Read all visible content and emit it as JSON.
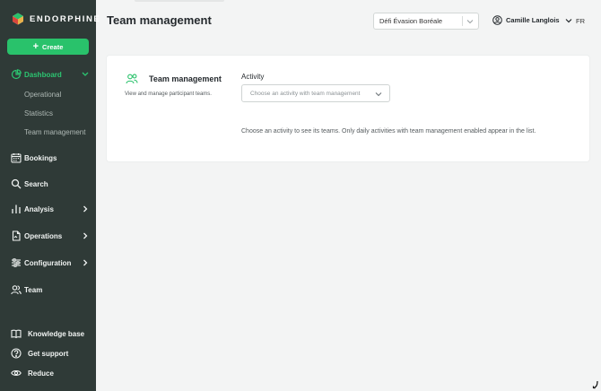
{
  "app": {
    "logo_text": "ENDORPHINE"
  },
  "sidebar": {
    "create_label": "Create",
    "nav": [
      {
        "label": "Dashboard",
        "icon": "chart-pie-icon",
        "active": true
      },
      {
        "label": "Bookings",
        "icon": "calendar-icon"
      },
      {
        "label": "Search",
        "icon": "search-icon"
      },
      {
        "label": "Analysis",
        "icon": "bar-chart-icon"
      },
      {
        "label": "Operations",
        "icon": "document-icon"
      },
      {
        "label": "Configuration",
        "icon": "sliders-icon"
      },
      {
        "label": "Team",
        "icon": "users-icon"
      }
    ],
    "sub_items": [
      "Operational",
      "Statistics",
      "Team management"
    ],
    "bottom": [
      {
        "label": "Knowledge base",
        "icon": "book-icon"
      },
      {
        "label": "Get support",
        "icon": "help-circle-icon"
      },
      {
        "label": "Reduce",
        "icon": "eye-icon"
      }
    ]
  },
  "header": {
    "title": "Team management",
    "organization": "Défi Évasion Boréale",
    "user_name": "Camille Langlois",
    "language": "FR"
  },
  "card": {
    "title": "Team management",
    "description": "View and manage participant teams.",
    "activity_label": "Activity",
    "activity_placeholder": "Choose an activity with team management",
    "hint": "Choose an activity to see its teams. Only daily activities with team management enabled appear in the list."
  },
  "colors": {
    "sidebar_bg": "#2f3a37",
    "accent_green": "#29c26b",
    "page_bg": "#f3f4f4"
  }
}
